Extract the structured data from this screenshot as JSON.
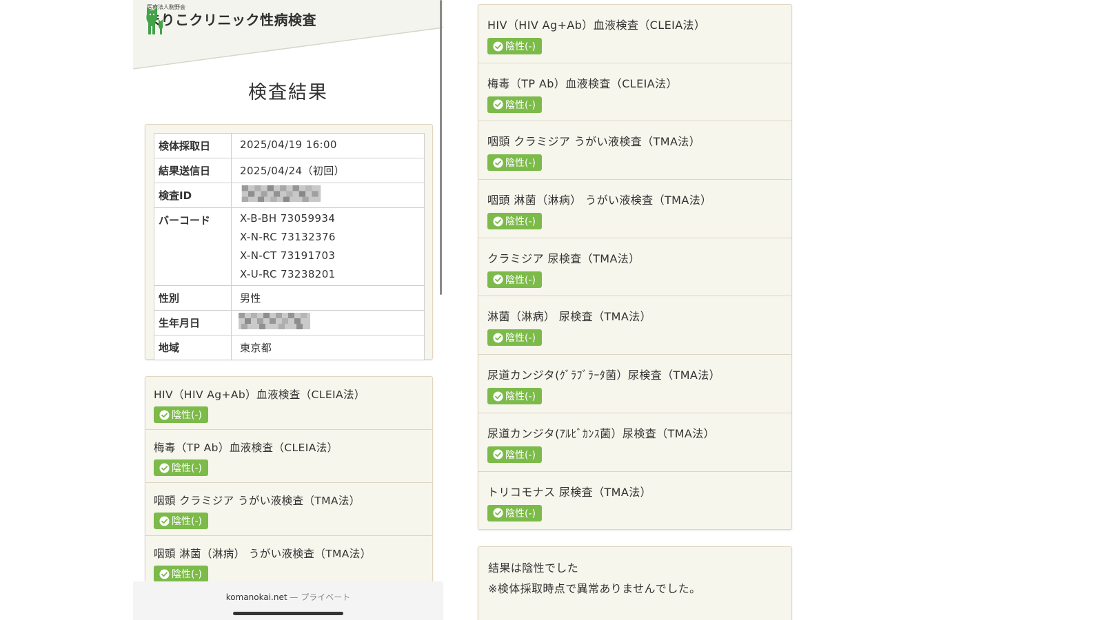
{
  "clinic": {
    "org_name": "医療法人駒野会",
    "name": "まりこクリニック性病検査"
  },
  "page_title": "検査結果",
  "info": {
    "collection_date_label": "検体採取日",
    "collection_date_value": "2025/04/19 16:00",
    "result_date_label": "結果送信日",
    "result_date_value": "2025/04/24（初回）",
    "test_id_label": "検査ID",
    "barcode_label": "バーコード",
    "barcodes": [
      "X-B-BH 73059934",
      "X-N-RC 73132376",
      "X-N-CT 73191703",
      "X-U-RC 73238201"
    ],
    "gender_label": "性別",
    "gender_value": "男性",
    "birthdate_label": "生年月日",
    "region_label": "地域",
    "region_value": "東京都"
  },
  "results": [
    {
      "name": "HIV（HIV Ag+Ab）血液検査（CLEIA法）",
      "status": "陰性(-)"
    },
    {
      "name": "梅毒（TP Ab）血液検査（CLEIA法）",
      "status": "陰性(-)"
    },
    {
      "name": "咽頭 クラミジア うがい液検査（TMA法）",
      "status": "陰性(-)"
    },
    {
      "name": "咽頭 淋菌（淋病） うがい液検査（TMA法）",
      "status": "陰性(-)"
    },
    {
      "name": "クラミジア 尿検査（TMA法）",
      "status": "陰性(-)"
    },
    {
      "name": "淋菌（淋病） 尿検査（TMA法）",
      "status": "陰性(-)"
    },
    {
      "name": "尿道カンジタ(ｸﾞﾗﾌﾞﾗｰﾀ菌）尿検査（TMA法）",
      "status": "陰性(-)"
    },
    {
      "name": "尿道カンジタ(ｱﾙﾋﾞｶﾝｽ菌）尿検査（TMA法）",
      "status": "陰性(-)"
    },
    {
      "name": "トリコモナス 尿検査（TMA法）",
      "status": "陰性(-)"
    }
  ],
  "summary": {
    "line1": "結果は陰性でした",
    "line2": "※検体採取時点で異常ありませんでした。"
  },
  "browser": {
    "domain": "komanokai.net",
    "separator": "—",
    "mode": "プライベート"
  },
  "colors": {
    "badge_green": "#7cba4a",
    "logo_green": "#43a24a",
    "card_bg": "#f6f6ec",
    "card_border": "#e1d6c0"
  },
  "icons": {
    "badge": "check-circle-icon",
    "logo": "cat-logo-icon"
  }
}
